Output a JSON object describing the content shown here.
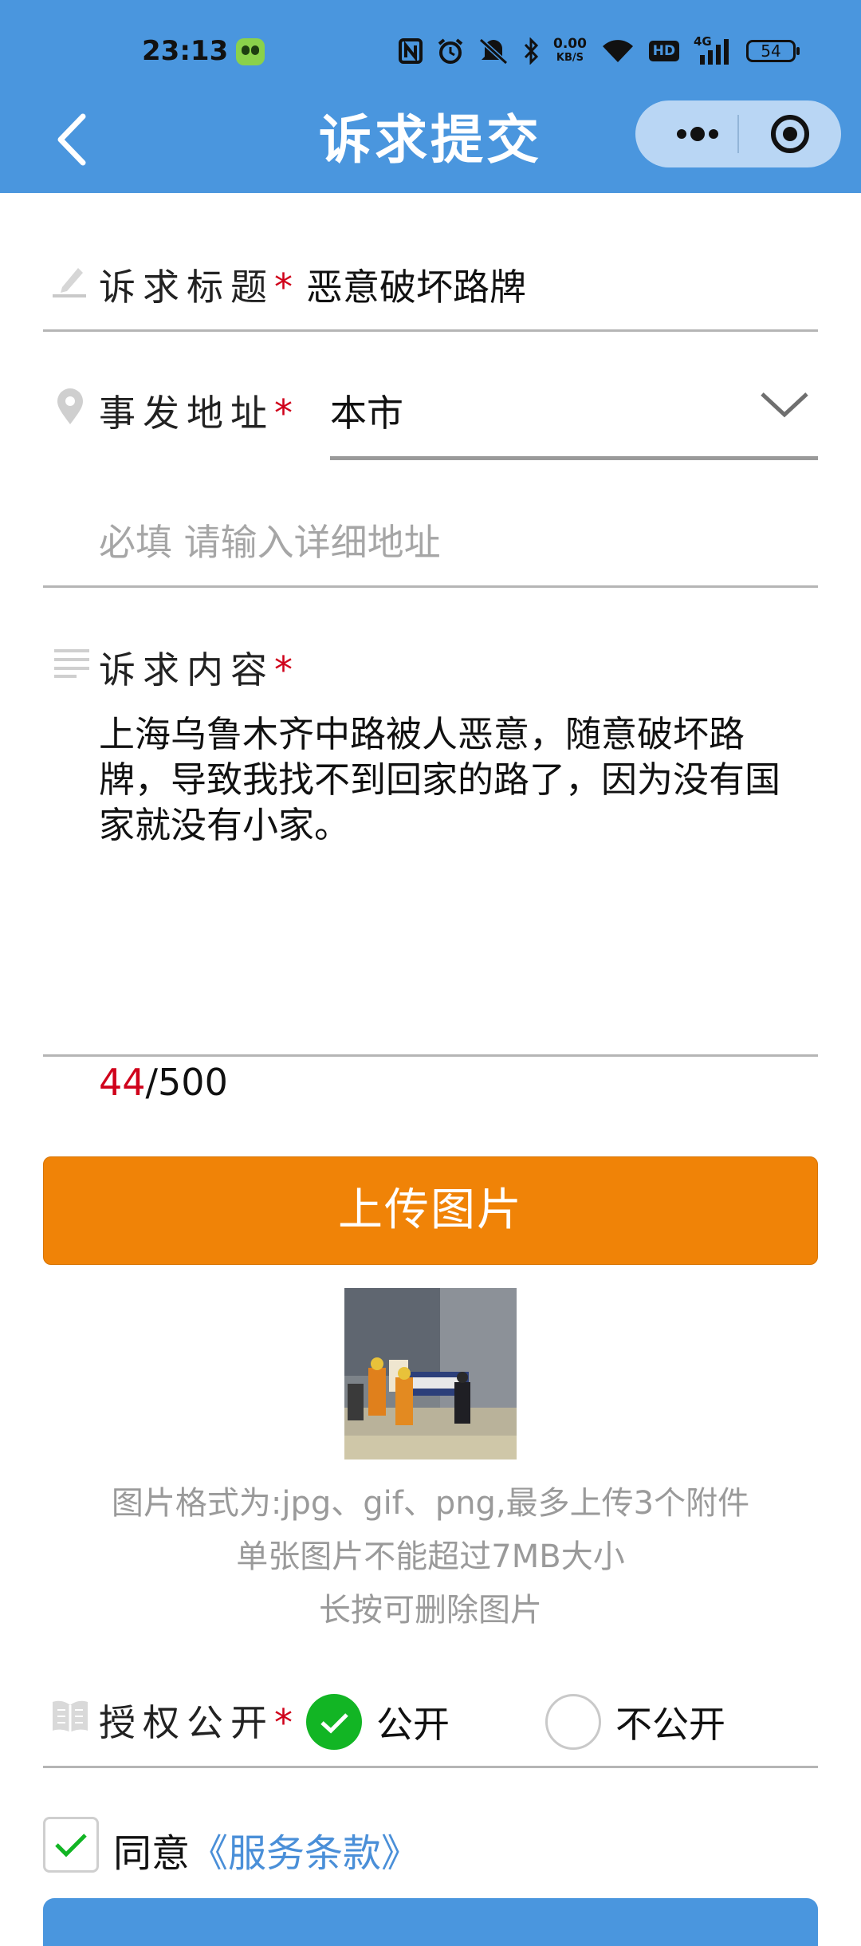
{
  "status_bar": {
    "time": "23:13",
    "net_speed_value": "0.00",
    "net_speed_unit": "KB/S",
    "signal_label": "4G",
    "hd_label": "HD",
    "battery_level": "54"
  },
  "nav": {
    "title": "诉求提交"
  },
  "form": {
    "title_label": "诉求标题",
    "title_value": "恶意破坏路牌",
    "address_label": "事发地址",
    "address_value": "本市",
    "detail_address_placeholder": "必填 请输入详细地址",
    "content_label": "诉求内容",
    "content_value": "上海乌鲁木齐中路被人恶意，随意破坏路牌，导致我找不到回家的路了，因为没有国家就没有小家。",
    "char_count": "44",
    "char_max": "/500",
    "required_mark": "*"
  },
  "upload": {
    "button_label": "上传图片",
    "note_format": "图片格式为:jpg、gif、png,最多上传3个附件",
    "note_size": "单张图片不能超过7MB大小",
    "note_delete": "长按可删除图片"
  },
  "publicity": {
    "label": "授权公开",
    "option_public": "公开",
    "option_private": "不公开",
    "selected": "公开"
  },
  "agreement": {
    "agree_text": "同意",
    "terms_link": "《服务条款》",
    "checked": true
  },
  "colors": {
    "header": "#4a96de",
    "upload_button": "#f08307",
    "required": "#d0021b",
    "radio_selected": "#12b524",
    "link": "#4a8fd8"
  }
}
